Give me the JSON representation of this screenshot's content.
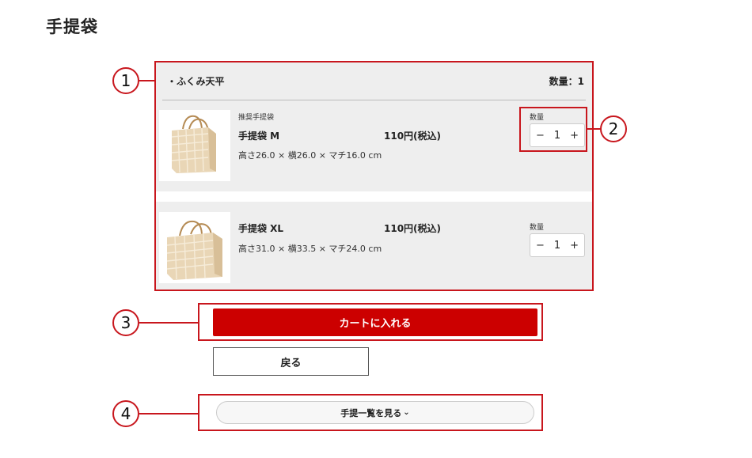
{
  "page": {
    "title": "手提袋"
  },
  "panel": {
    "shop_name": "・ふくみ天平",
    "qty_total": "数量：1",
    "items": [
      {
        "category": "推奨手提袋",
        "name": "手提袋 M",
        "price": "110円(税込)",
        "size": "高さ26.0 × 横26.0 × マチ16.0 cm",
        "qty_label": "数量",
        "qty_minus": "−",
        "qty_value": "1",
        "qty_plus": "+",
        "image_icon": "paper-bag-icon"
      },
      {
        "category": "",
        "name": "手提袋 XL",
        "price": "110円(税込)",
        "size": "高さ31.0 × 横33.5 × マチ24.0 cm",
        "qty_label": "数量",
        "qty_minus": "−",
        "qty_value": "1",
        "qty_plus": "+",
        "image_icon": "paper-bag-icon"
      }
    ]
  },
  "buttons": {
    "cart": "カートに入れる",
    "back": "戻る",
    "list": "手提一覧を見る",
    "list_chevron": "⌄"
  },
  "callouts": [
    "1",
    "2",
    "3",
    "4"
  ],
  "colors": {
    "accent": "#cc0000",
    "callout": "#c8161d",
    "panel_bg": "#eeeeee"
  }
}
